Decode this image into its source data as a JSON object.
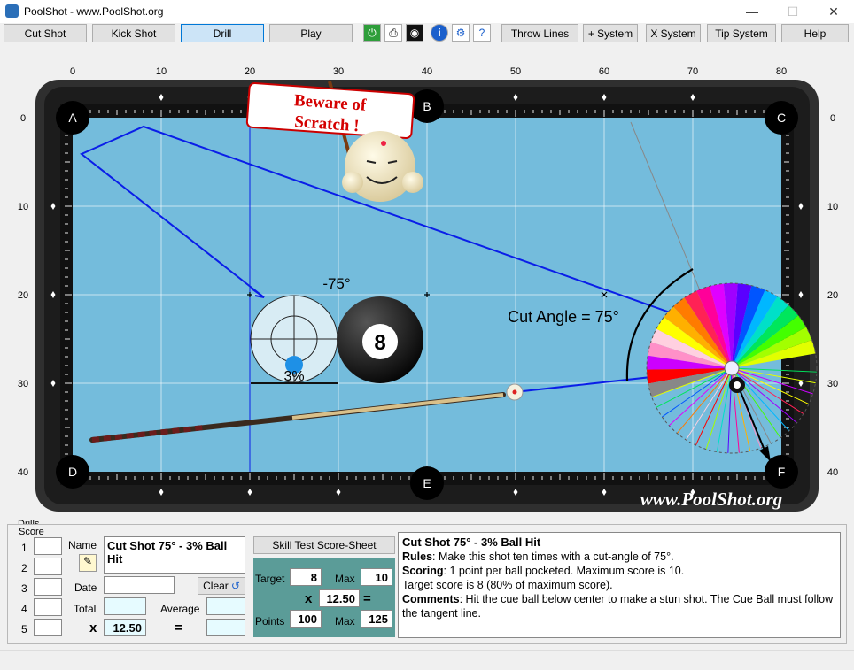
{
  "window": {
    "title": "PoolShot - www.PoolShot.org",
    "minimize": "—",
    "maximize": "☐",
    "close": "✕"
  },
  "toolbar": {
    "buttons": [
      "Cut Shot",
      "Kick Shot",
      "Drill",
      "Play"
    ],
    "active": "Drill",
    "icons": [
      "power-icon",
      "printer-icon",
      "camera-icon",
      "info-icon",
      "gear-icon",
      "help-doc-icon"
    ],
    "right_buttons": [
      "Throw Lines",
      "+ System",
      "X System",
      "Tip System",
      "Help"
    ]
  },
  "table": {
    "x_ticks": [
      "0",
      "10",
      "20",
      "30",
      "40",
      "50",
      "60",
      "70",
      "80"
    ],
    "y_ticks": [
      "0",
      "10",
      "20",
      "30",
      "40"
    ],
    "pockets": [
      "A",
      "B",
      "C",
      "D",
      "E",
      "F"
    ],
    "sign_line1": "Beware of",
    "sign_line2": "Scratch !",
    "angle_label": "-75°",
    "percent_label": "3%",
    "cut_angle_label": "Cut Angle = 75°",
    "object_ball_number": "8",
    "watermark": "www.PoolShot.org"
  },
  "drills": {
    "group_label": "Drills",
    "score_label": "Score",
    "rows": [
      "1",
      "2",
      "3",
      "4",
      "5"
    ],
    "name_label": "Name",
    "name_value": "Cut Shot 75° - 3% Ball Hit",
    "date_label": "Date",
    "clear_label": "Clear",
    "total_label": "Total",
    "average_label": "Average",
    "x_symbol": "x",
    "eq_symbol": "=",
    "multiplier": "12.50",
    "skill_button": "Skill Test Score-Sheet",
    "target_label": "Target",
    "target_value": "8",
    "max_label": "Max",
    "max_value": "10",
    "mult_value": "12.50",
    "points_label": "Points",
    "points_value": "100",
    "max2_label": "Max",
    "max2_value": "125"
  },
  "description": {
    "title": "Cut Shot 75° - 3% Ball Hit",
    "rules_label": "Rules",
    "rules_text": ": Make this shot  ten times with a cut-angle of 75°.",
    "scoring_label": "Scoring",
    "scoring_text": ": 1 point per ball pocketed. Maximum score is 10.",
    "target_text": "Target score is 8 (80% of maximum score).",
    "comments_label": "Comments",
    "comments_text": ": Hit the cue ball below center to make a stun shot. The Cue Ball must follow the tangent line."
  },
  "colors": {
    "felt": "#74bcdc",
    "rail": "#2a2a2a",
    "line": "#0a1ee8",
    "teal_panel": "#5b9c98"
  }
}
